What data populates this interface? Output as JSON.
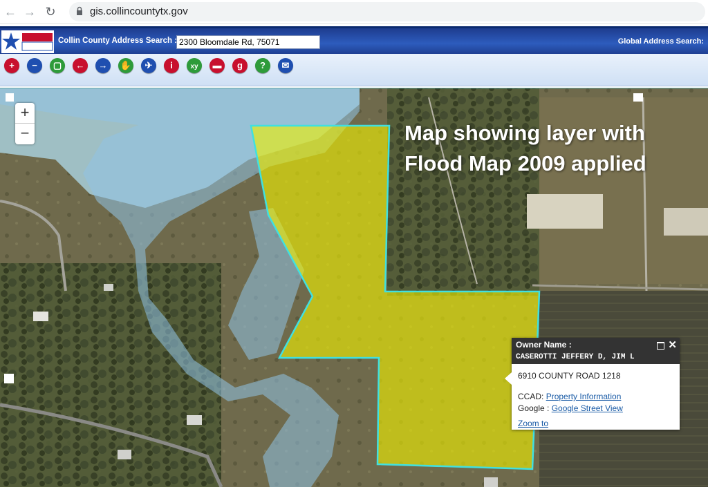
{
  "browser": {
    "url": "gis.collincountytx.gov",
    "back_icon": "back-arrow-icon",
    "forward_icon": "forward-arrow-icon",
    "reload_icon": "reload-icon"
  },
  "header": {
    "logo_text": "COLLIN COUNTY",
    "search_label": "Collin County Address Search :",
    "search_value": "2300 Bloomdale Rd, 75071",
    "global_label": "Global Address Search:"
  },
  "toolbar": {
    "tools": [
      {
        "name": "zoom-in-tool",
        "icon": "plus-icon",
        "color": "#c8102e",
        "glyph": "+"
      },
      {
        "name": "zoom-out-tool",
        "icon": "minus-icon",
        "color": "#1f4fb0",
        "glyph": "−"
      },
      {
        "name": "full-extent-tool",
        "icon": "page-icon",
        "color": "#2e9b3a",
        "glyph": "▢"
      },
      {
        "name": "previous-extent-tool",
        "icon": "left-arrow-icon",
        "color": "#c8102e",
        "glyph": "←"
      },
      {
        "name": "next-extent-tool",
        "icon": "right-arrow-icon",
        "color": "#1f4fb0",
        "glyph": "→"
      },
      {
        "name": "pan-tool",
        "icon": "hand-icon",
        "color": "#2e9b3a",
        "glyph": "✋"
      },
      {
        "name": "measure-tool",
        "icon": "person-icon",
        "color": "#1f4fb0",
        "glyph": "✈"
      },
      {
        "name": "identify-tool",
        "icon": "info-icon",
        "color": "#c8102e",
        "glyph": "i"
      },
      {
        "name": "xy-tool",
        "icon": "xy-icon",
        "color": "#2e9b3a",
        "glyph": "xy"
      },
      {
        "name": "ruler-tool",
        "icon": "ruler-icon",
        "color": "#c8102e",
        "glyph": "▬"
      },
      {
        "name": "google-tool",
        "icon": "google-icon",
        "color": "#c8102e",
        "glyph": "g"
      },
      {
        "name": "help-tool",
        "icon": "question-icon",
        "color": "#2e9b3a",
        "glyph": "?"
      },
      {
        "name": "email-tool",
        "icon": "envelope-icon",
        "color": "#1f4fb0",
        "glyph": "✉"
      }
    ]
  },
  "map": {
    "zoom_in": "+",
    "zoom_out": "−",
    "annotation_line1": "Map showing layer with",
    "annotation_line2": "Flood Map 2009 applied",
    "flood_color": "#8fc3e6",
    "parcel_color": "#f0f000",
    "parcel_outline": "#40e0e0"
  },
  "popup": {
    "title": "Owner Name :",
    "owner": "CASEROTTI JEFFERY D, JIM L",
    "address": "6910 COUNTY ROAD 1218",
    "ccad_label": "CCAD:",
    "ccad_link": "Property Information",
    "google_label": "Google :",
    "google_link": "Google Street View",
    "zoom_link": "Zoom to"
  }
}
